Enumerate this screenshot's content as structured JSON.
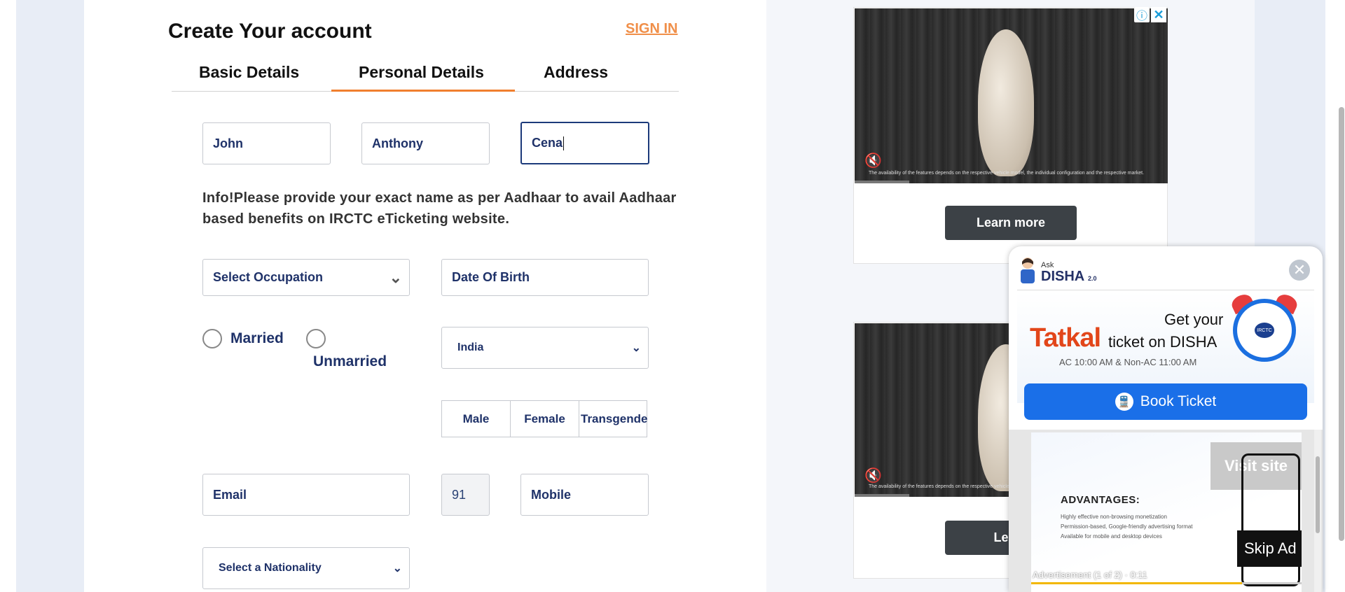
{
  "form": {
    "title": "Create Your account",
    "signin": "SIGN IN",
    "tabs": [
      "Basic Details",
      "Personal Details",
      "Address"
    ],
    "first_name": "John",
    "middle_name": "Anthony",
    "last_name": "Cena",
    "info": "Info!Please provide your exact name as per Aadhaar to avail Aadhaar based benefits on IRCTC eTicketing website.",
    "occupation_placeholder": "Select Occupation",
    "dob_placeholder": "Date Of Birth",
    "marital": {
      "married": "Married",
      "unmarried": "Unmarried"
    },
    "country": "India",
    "gender": {
      "male": "Male",
      "female": "Female",
      "transgender": "Transgende"
    },
    "email_placeholder": "Email",
    "isd_code": "91",
    "mobile_placeholder": "Mobile",
    "nationality_placeholder": "Select a Nationality"
  },
  "ads": {
    "learn_more": "Learn more",
    "learn_partial": "Learn",
    "disclaimer": "The availability of the features depends on the respective vehicle model, the individual configuration and the respective market.",
    "adchoices_icon": "info-icon",
    "close_icon": "close-icon"
  },
  "disha": {
    "ask": "Ask",
    "name": "DISHA",
    "version": "2.0",
    "tatkal": "Tatkal",
    "get_your": "Get your",
    "ticket_on": "ticket on DISHA",
    "timing": "AC 10:00 AM & Non-AC 11:00 AM",
    "book_ticket": "Book Ticket",
    "clock_label": "IRCTC",
    "inner_ad": {
      "visit_site": "Visit site",
      "advantages": "ADVANTAGES:",
      "items": [
        "Highly effective non-browsing monetization",
        "Permission-based, Google-friendly advertising format",
        "Available for mobile and desktop devices"
      ],
      "skip": "Skip Ad",
      "counter": "Advertisement (1 of 2) · 0:11",
      "progress_fraction": 0.78
    }
  },
  "colors": {
    "accent_orange": "#f07f2e",
    "navy_text": "#1f3269",
    "book_blue": "#1a6fe8",
    "tatkal_red": "#e2461a"
  }
}
